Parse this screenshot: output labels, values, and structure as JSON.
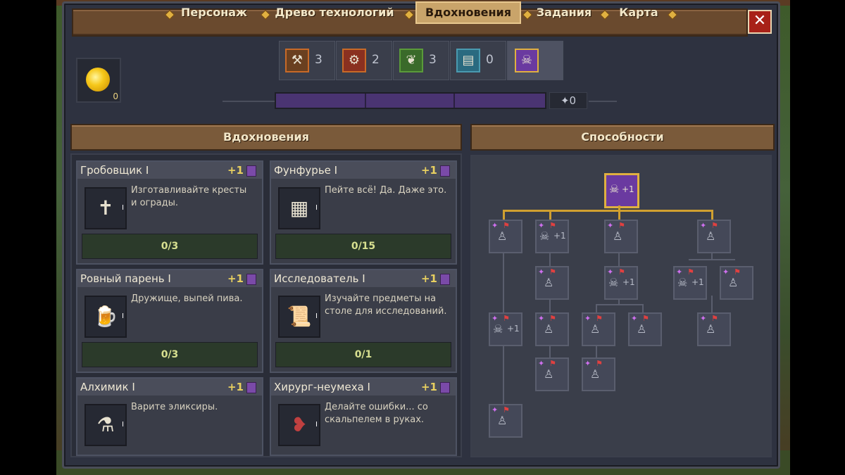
{
  "nav": {
    "tabs": [
      {
        "label": "Персонаж"
      },
      {
        "label": "Древо технологий"
      },
      {
        "label": "Вдохновения"
      },
      {
        "label": "Задания"
      },
      {
        "label": "Карта"
      }
    ],
    "active_tab": "Вдохновения",
    "close_label": "✕"
  },
  "currency": {
    "count": "0"
  },
  "categories": [
    {
      "icon": "hammer-icon",
      "count": "3"
    },
    {
      "icon": "gear-icon",
      "count": "2"
    },
    {
      "icon": "wheat-icon",
      "count": "3"
    },
    {
      "icon": "book-icon",
      "count": "0"
    },
    {
      "icon": "skull-icon",
      "count": ""
    }
  ],
  "points": {
    "value": "0"
  },
  "sections": {
    "inspirations": "Вдохновения",
    "abilities": "Способности"
  },
  "cards": [
    {
      "title": "Гробовщик I",
      "cost": "+1",
      "desc": "Изготавливайте кресты и ограды.",
      "progress": "0/3",
      "icon": "cross-icon"
    },
    {
      "title": "Фунфурье I",
      "cost": "+1",
      "desc": "Пейте всё! Да. Даже это.",
      "progress": "0/15",
      "icon": "crate-icon"
    },
    {
      "title": "Ровный парень I",
      "cost": "+1",
      "desc": "Дружище, выпей пива.",
      "progress": "0/3",
      "icon": "beer-icon"
    },
    {
      "title": "Исследователь I",
      "cost": "+1",
      "desc": "Изучайте предметы на столе для исследований.",
      "progress": "0/1",
      "icon": "scroll-icon"
    },
    {
      "title": "Алхимик I",
      "cost": "+1",
      "desc": "Варите эликсиры.",
      "progress": "",
      "icon": "potion-icon"
    },
    {
      "title": "Хирург-неумеха I",
      "cost": "+1",
      "desc": "Делайте ошибки... со скальпелем в руках.",
      "progress": "",
      "icon": "meat-icon"
    }
  ],
  "skills": {
    "root_plus": "+1",
    "node_plus": "+1"
  },
  "colors": {
    "accent": "#d0a030",
    "purple": "#6a3aa0",
    "wood": "#7a5a3a"
  }
}
